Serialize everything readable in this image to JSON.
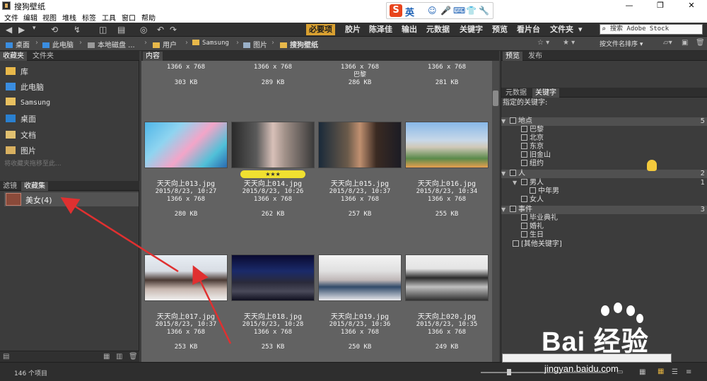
{
  "window": {
    "title": "搜狗壁纸",
    "buttons": [
      "—",
      "❐",
      "✕"
    ]
  },
  "menu": {
    "items": [
      "文件",
      "编辑",
      "视图",
      "堆栈",
      "标签",
      "工具",
      "窗口",
      "帮助"
    ]
  },
  "ime": {
    "logo": "S",
    "lang": "英",
    "icons": [
      "☺",
      "🎤",
      "⌨",
      "👕",
      "🔧"
    ]
  },
  "toolbar": {
    "workspaces": [
      "必要项",
      "胶片",
      "陈泽佳",
      "输出",
      "元数据",
      "关键字",
      "预览",
      "看片台",
      "文件夹"
    ],
    "active_workspace": "必要项",
    "more": "▾",
    "search_placeholder": "搜索 Adobe Stock"
  },
  "path": {
    "crumbs": [
      "桌面",
      "此电脑",
      "本地磁盘 ...",
      "用户",
      "Samsung",
      "图片",
      "搜狗壁纸"
    ],
    "sort_label": "按文件名排序"
  },
  "left_panel": {
    "top_tabs": [
      "收藏夹",
      "文件夹"
    ],
    "favorites": [
      {
        "label": "库",
        "icon": "library-icon"
      },
      {
        "label": "此电脑",
        "icon": "computer-icon"
      },
      {
        "label": "Samsung",
        "icon": "user-folder-icon"
      },
      {
        "label": "桌面",
        "icon": "desktop-icon"
      },
      {
        "label": "文档",
        "icon": "documents-icon"
      },
      {
        "label": "图片",
        "icon": "pictures-icon"
      }
    ],
    "drag_hint": "将收藏夹拖移至此...",
    "bottom_tabs": [
      "滤镜",
      "收藏集"
    ],
    "collection": "美女(4)"
  },
  "content": {
    "tab": "内容",
    "top_row": [
      {
        "dims": "1366 x 768",
        "size": "303 KB",
        "extra": ""
      },
      {
        "dims": "1366 x 768",
        "size": "289 KB",
        "extra": ""
      },
      {
        "dims": "1366 x 768",
        "size": "286 KB",
        "extra": "巴黎"
      },
      {
        "dims": "1366 x 768",
        "size": "281 KB",
        "extra": ""
      }
    ],
    "row2": [
      {
        "name": "天天向上013.jpg",
        "date": "2015/8/23, 10:27",
        "dims": "1366 x 768",
        "size": "280 KB",
        "rating": ""
      },
      {
        "name": "天天向上014.jpg",
        "date": "2015/8/23, 10:26",
        "dims": "1366 x 768",
        "size": "262 KB",
        "rating": "★★★"
      },
      {
        "name": "天天向上015.jpg",
        "date": "2015/8/23, 10:37",
        "dims": "1366 x 768",
        "size": "257 KB",
        "rating": ""
      },
      {
        "name": "天天向上016.jpg",
        "date": "2015/8/23, 10:34",
        "dims": "1366 x 768",
        "size": "255 KB",
        "rating": ""
      }
    ],
    "row3": [
      {
        "name": "天天向上017.jpg",
        "date": "2015/8/23, 10:37",
        "dims": "1366 x 768",
        "size": "253 KB"
      },
      {
        "name": "天天向上018.jpg",
        "date": "2015/8/23, 10:28",
        "dims": "1366 x 768",
        "size": "253 KB"
      },
      {
        "name": "天天向上019.jpg",
        "date": "2015/8/23, 10:36",
        "dims": "1366 x 768",
        "size": "250 KB"
      },
      {
        "name": "天天向上020.jpg",
        "date": "2015/8/23, 10:35",
        "dims": "1366 x 768",
        "size": "249 KB"
      }
    ]
  },
  "right_panel": {
    "top_tabs": [
      "预览",
      "发布"
    ],
    "tabs": [
      "元数据",
      "关键字"
    ],
    "assigned_label": "指定的关键字:",
    "keywords": [
      {
        "label": "地点",
        "count": "5",
        "group": true,
        "indent": 0
      },
      {
        "label": "巴黎",
        "count": "",
        "group": false,
        "indent": 1
      },
      {
        "label": "北京",
        "count": "",
        "group": false,
        "indent": 1
      },
      {
        "label": "东京",
        "count": "",
        "group": false,
        "indent": 1
      },
      {
        "label": "旧金山",
        "count": "",
        "group": false,
        "indent": 1
      },
      {
        "label": "纽约",
        "count": "",
        "group": false,
        "indent": 1
      },
      {
        "label": "人",
        "count": "2",
        "group": true,
        "indent": 0
      },
      {
        "label": "男人",
        "count": "1",
        "group": false,
        "indent": 1,
        "expand": true
      },
      {
        "label": "中年男",
        "count": "",
        "group": false,
        "indent": 2
      },
      {
        "label": "女人",
        "count": "",
        "group": false,
        "indent": 1
      },
      {
        "label": "事件",
        "count": "3",
        "group": true,
        "indent": 0
      },
      {
        "label": "毕业典礼",
        "count": "",
        "group": false,
        "indent": 1
      },
      {
        "label": "婚礼",
        "count": "",
        "group": false,
        "indent": 1
      },
      {
        "label": "生日",
        "count": "",
        "group": false,
        "indent": 1
      },
      {
        "label": "[其他关键字]",
        "count": "",
        "group": false,
        "indent": 0,
        "plain": true
      }
    ]
  },
  "status": {
    "count": "146 个项目"
  },
  "watermark": {
    "text": "Bai  经验",
    "url": "jingyan.baidu.com"
  },
  "colors": {
    "accent": "#d9a030",
    "annotation": "#e03030"
  }
}
